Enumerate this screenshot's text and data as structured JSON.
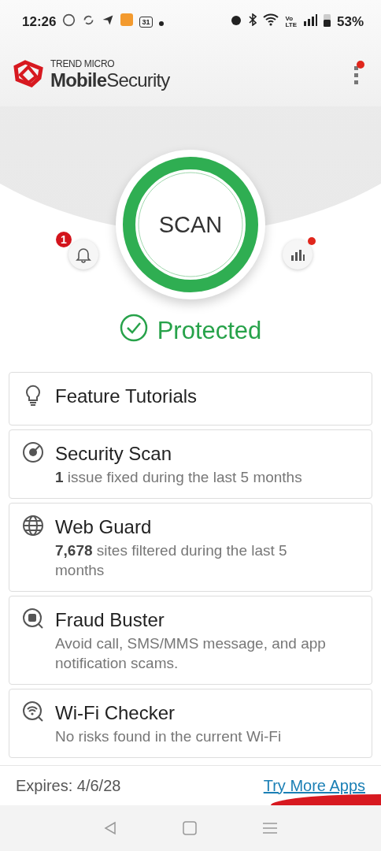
{
  "status_bar": {
    "time": "12:26",
    "calendar_date": "31",
    "network_label": [
      "Vo",
      "LTE"
    ],
    "battery": "53%"
  },
  "header": {
    "brand_top": "TREND MICRO",
    "brand_name": "**Mobile**Security",
    "menu_badge": true
  },
  "hero": {
    "scan_label": "SCAN",
    "notification_count": "1",
    "stats_badge": true,
    "status": "Protected"
  },
  "cards": [
    {
      "title": "Feature Tutorials"
    },
    {
      "title": "Security Scan",
      "description": "**1** issue fixed during the last 5 months"
    },
    {
      "title": "Web Guard",
      "description": "**7,678** sites filtered during the last 5 months"
    },
    {
      "title": "Fraud Buster",
      "description": "Avoid call, SMS/MMS message, and app notification scams."
    },
    {
      "title": "Wi-Fi Checker",
      "description": "No risks found in the current Wi-Fi"
    }
  ],
  "footer": {
    "expires": "Expires: 4/6/28",
    "link": "Try More Apps"
  }
}
